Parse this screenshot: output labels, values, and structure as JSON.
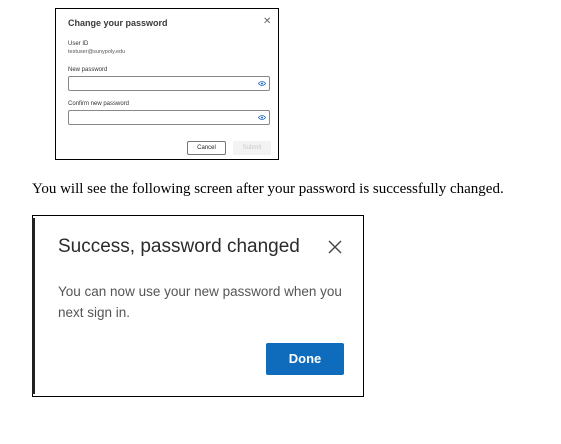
{
  "change_dialog": {
    "title": "Change your password",
    "user_id_label": "User ID",
    "user_id_value": "testuser@sunypoly.edu",
    "new_password_label": "New password",
    "new_password_value": "",
    "confirm_password_label": "Confirm new password",
    "confirm_password_value": "",
    "cancel_label": "Cancel",
    "submit_label": "Submit"
  },
  "caption": "You will see the following screen after your password is successfully changed.",
  "success_dialog": {
    "title": "Success, password changed",
    "message": "You can now use your new password when you next sign in.",
    "done_label": "Done",
    "accent_color": "#0f6cbd"
  },
  "icons": {
    "close": "close-icon",
    "reveal": "eye-icon"
  }
}
